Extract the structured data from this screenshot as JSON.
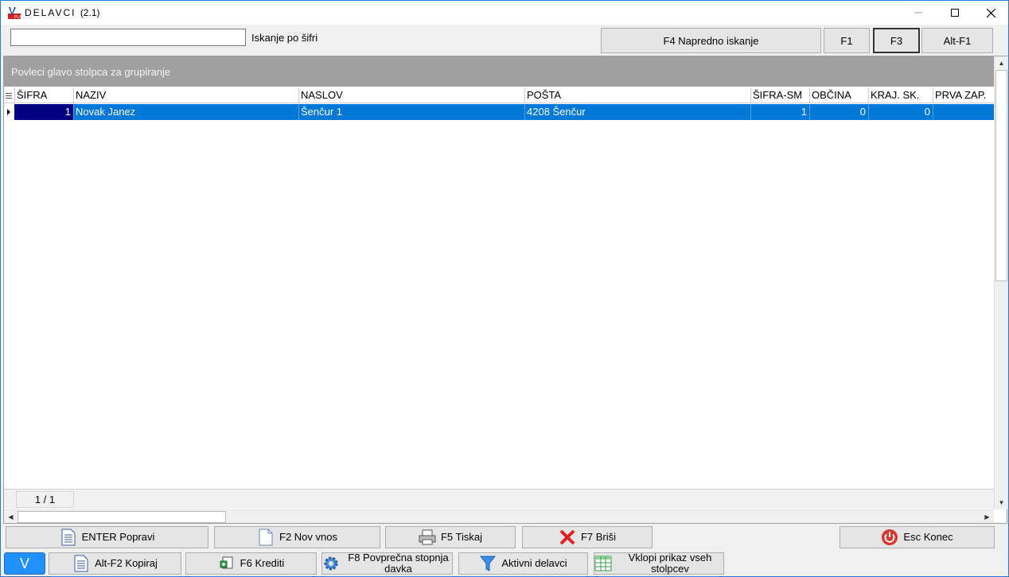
{
  "window": {
    "title": "DELAVCI",
    "version": "(2.1)"
  },
  "toolbar": {
    "search_value": "",
    "search_label": "Iskanje po šifri",
    "advanced_search": "F4  Napredno iskanje",
    "f1": "F1",
    "f3": "F3",
    "alt_f1": "Alt-F1"
  },
  "grid": {
    "group_hint": "Povleci glavo stolpca za grupiranje",
    "columns": [
      "ŠIFRA",
      "NAZIV",
      "NASLOV",
      "POŠTA",
      "ŠIFRA-SM",
      "OBČINA",
      "KRAJ. SK.",
      "PRVA ZAP."
    ],
    "rows": [
      [
        "1",
        "Novak Janez",
        "Šenčur 1",
        "4208 Šenčur",
        "1",
        "0",
        "0",
        ""
      ]
    ],
    "pager": "1 / 1"
  },
  "buttons_row1": {
    "edit": "ENTER Popravi",
    "new": "F2 Nov vnos",
    "print": "F5 Tiskaj",
    "delete": "F7 Briši",
    "exit": "Esc Konec"
  },
  "buttons_row2": {
    "v": "V",
    "copy": "Alt-F2 Kopiraj",
    "credits": "F6 Krediti",
    "avg_tax": "F8  Povprečna stopnja davka",
    "active": "Aktivni delavci",
    "all_columns": "Vklopi prikaz vseh stolpcev"
  },
  "colors": {
    "selection": "#0078d7",
    "focus_cell": "#000080",
    "group_bar": "#a0a0a0",
    "delete_red": "#e02020",
    "exit_red": "#d9362b"
  }
}
